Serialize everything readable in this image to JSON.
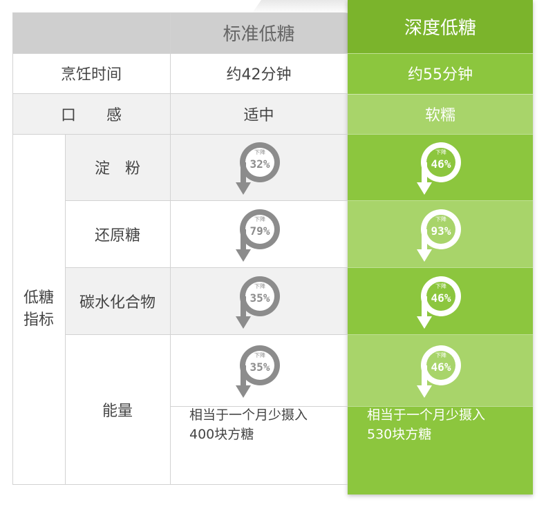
{
  "header": {
    "col_standard": "标准低糖",
    "col_deep": "深度低糖"
  },
  "rows": {
    "cook_time": {
      "label": "烹饪时间",
      "standard": "约42分钟",
      "deep": "约55分钟"
    },
    "taste": {
      "label": "口　　感",
      "standard": "适中",
      "deep": "软糯"
    }
  },
  "category": {
    "label_line1": "低糖",
    "label_line2": "指标"
  },
  "indicators": [
    {
      "label": "淀　粉",
      "standard": {
        "tag": "下降",
        "value": "32%"
      },
      "deep": {
        "tag": "下降",
        "value": "46%"
      }
    },
    {
      "label": "还原糖",
      "standard": {
        "tag": "下降",
        "value": "79%"
      },
      "deep": {
        "tag": "下降",
        "value": "93%"
      }
    },
    {
      "label": "碳水化合物",
      "standard": {
        "tag": "下降",
        "value": "35%"
      },
      "deep": {
        "tag": "下降",
        "value": "46%"
      }
    },
    {
      "label": "能量",
      "standard": {
        "tag": "下降",
        "value": "35%"
      },
      "deep": {
        "tag": "下降",
        "value": "46%"
      }
    }
  ],
  "energy_note": {
    "standard": {
      "line1": "相当于一个月少摄入",
      "line2": "400块方糖"
    },
    "deep": {
      "line1": "相当于一个月少摄入",
      "line2": "530块方糖"
    }
  },
  "colors": {
    "green": "#8cc63e",
    "green_dark": "#7bb42c",
    "green_light": "#a8d46a",
    "gray_header": "#cfcfcf",
    "arrow_gray": "#8c8c8c"
  },
  "icons": {
    "badge": "down-arrow-percent-icon"
  }
}
